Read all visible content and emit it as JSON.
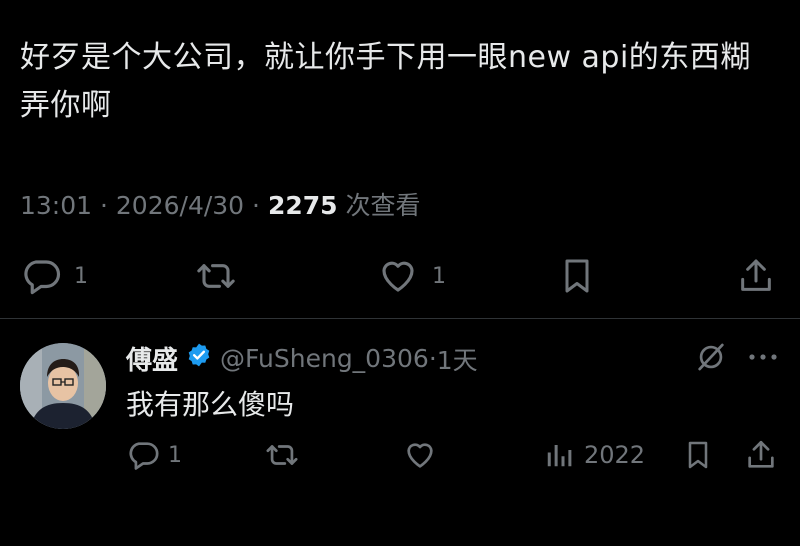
{
  "tweet": {
    "text": "好歹是个大公司，就让你手下用一眼new api的东西糊弄你啊",
    "time": "13:01",
    "date": "2026/4/30",
    "views_count": "2275",
    "views_label": "次查看",
    "separator": "·"
  },
  "actions": {
    "reply_count": "1",
    "retweet_count": "",
    "like_count": "1"
  },
  "reply": {
    "display_name": "傅盛",
    "handle": "@FuSheng_0306",
    "separator": "·",
    "time_ago": "1天",
    "text": "我有那么傻吗",
    "reply_count": "1",
    "views_count": "2022"
  },
  "colors": {
    "background": "#000000",
    "text_primary": "#e7e9ea",
    "text_secondary": "#71767b",
    "verified_blue": "#1d9bf0",
    "divider": "#2f3336"
  },
  "icons": [
    "reply-icon",
    "retweet-icon",
    "like-icon",
    "bookmark-icon",
    "share-icon",
    "verified-badge-icon",
    "grok-icon",
    "more-icon",
    "views-icon"
  ]
}
